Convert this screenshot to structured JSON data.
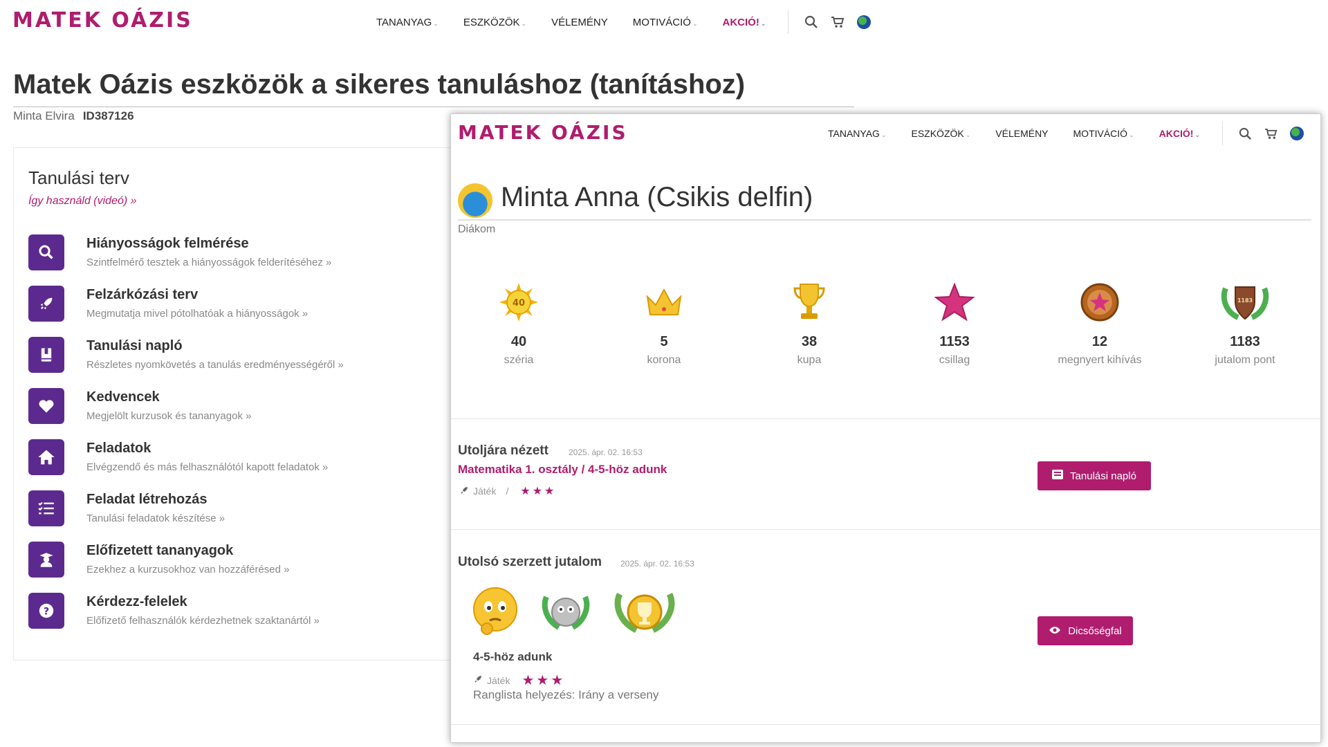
{
  "brand": {
    "logo": "MATEK OÁZIS",
    "color": "#b01c6e"
  },
  "nav": {
    "items": [
      {
        "label": "TANANYAG",
        "dropdown": true
      },
      {
        "label": "ESZKÖZÖK",
        "dropdown": true
      },
      {
        "label": "VÉLEMÉNY",
        "dropdown": false
      },
      {
        "label": "MOTIVÁCIÓ",
        "dropdown": true
      },
      {
        "label": "AKCIÓ!",
        "dropdown": true
      }
    ],
    "icons": [
      "search-icon",
      "cart-icon",
      "globe-icon"
    ]
  },
  "page": {
    "title": "Matek Oázis eszközök a sikeres tanuláshoz (tanításhoz)",
    "user_name": "Minta Elvira",
    "user_id": "ID387126"
  },
  "plan": {
    "title": "Tanulási terv",
    "video_link": "Így használd (videó) »",
    "items": [
      {
        "icon": "search-icon",
        "title": "Hiányosságok felmérése",
        "desc": "Szintfelmérő tesztek a hiányosságok felderítéséhez »"
      },
      {
        "icon": "rocket-icon",
        "title": "Felzárkózási terv",
        "desc": "Megmutatja mivel pótolhatóak a hiányosságok »"
      },
      {
        "icon": "book-icon",
        "title": "Tanulási napló",
        "desc": "Részletes nyomkövetés a tanulás eredményességéről »"
      },
      {
        "icon": "heart-icon",
        "title": "Kedvencek",
        "desc": "Megjelölt kurzusok és tananyagok »"
      },
      {
        "icon": "home-icon",
        "title": "Feladatok",
        "desc": "Elvégzendő és más felhasználótól kapott feladatok »"
      },
      {
        "icon": "task-list-icon",
        "title": "Feladat létrehozás",
        "desc": "Tanulási feladatok készítése »"
      },
      {
        "icon": "graduate-icon",
        "title": "Előfizetett tananyagok",
        "desc": "Ezekhez a kurzusokhoz van hozzáférésed »"
      },
      {
        "icon": "question-icon",
        "title": "Kérdezz-felelek",
        "desc": "Előfizető felhasználók kérdezhetnek szaktanártól »"
      }
    ]
  },
  "student": {
    "name": "Minta Anna (Csikis delfin)",
    "role": "Diákom",
    "stats": [
      {
        "icon": "sun-badge-icon",
        "value": "40",
        "label": "széria",
        "badge_text": "40"
      },
      {
        "icon": "crown-icon",
        "value": "5",
        "label": "korona"
      },
      {
        "icon": "trophy-icon",
        "value": "38",
        "label": "kupa"
      },
      {
        "icon": "star-icon",
        "value": "1153",
        "label": "csillag"
      },
      {
        "icon": "challenge-medal-icon",
        "value": "12",
        "label": "megnyert kihívás"
      },
      {
        "icon": "laurel-shield-icon",
        "value": "1183",
        "label": "jutalom pont",
        "badge_text": "1183"
      }
    ],
    "last_viewed": {
      "title": "Utoljára nézett",
      "date": "2025. ápr. 02. 16:53",
      "link": "Matematika 1. osztály / 4-5-höz adunk",
      "type": "Játék",
      "separator": "/",
      "stars": 3,
      "button": "Tanulási napló"
    },
    "last_award": {
      "title": "Utolsó szerzett jutalom",
      "date": "2025. ápr. 02. 16:53",
      "icons": [
        "thinking-emoji-icon",
        "silver-owl-medal-icon",
        "gold-trophy-medal-icon"
      ],
      "item": "4-5-höz adunk",
      "type": "Játék",
      "stars": 3,
      "rank_text": "Ranglista helyezés: Irány a verseny",
      "button": "Dicsőségfal"
    }
  }
}
